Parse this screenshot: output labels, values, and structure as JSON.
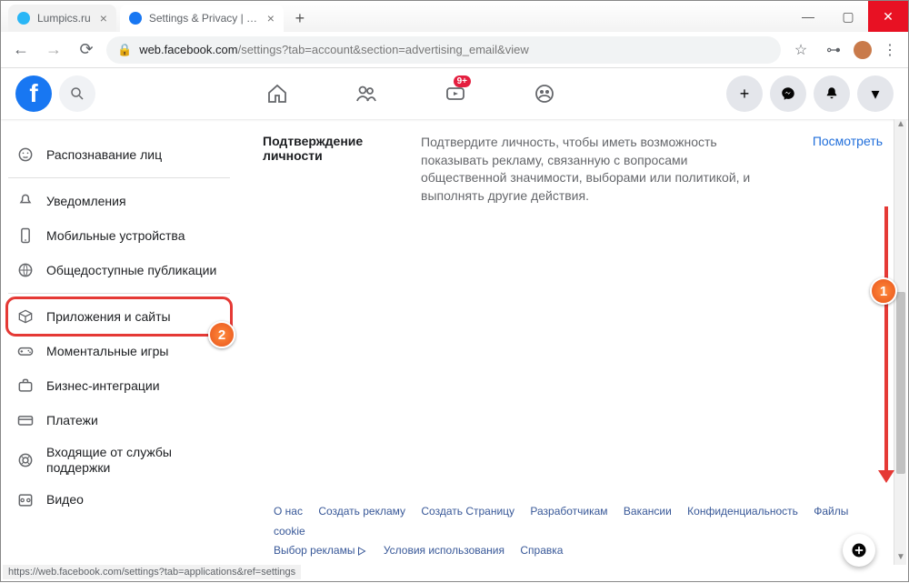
{
  "browser": {
    "tabs": [
      {
        "title": "Lumpics.ru",
        "favicon_color": "#29b6f6",
        "active": false
      },
      {
        "title": "Settings & Privacy | Facebook",
        "favicon_color": "#1877f2",
        "active": true
      }
    ],
    "url_host": "web.facebook.com",
    "url_path": "/settings?tab=account&section=advertising_email&view",
    "status_url": "https://web.facebook.com/settings?tab=applications&ref=settings"
  },
  "fb_header": {
    "logo_letter": "f",
    "watch_badge": "9+"
  },
  "sidebar": {
    "items": [
      {
        "label": "Распознавание лиц"
      },
      {
        "label": "Уведомления"
      },
      {
        "label": "Мобильные устройства"
      },
      {
        "label": "Общедоступные публикации"
      },
      {
        "label": "Приложения и сайты"
      },
      {
        "label": "Моментальные игры"
      },
      {
        "label": "Бизнес-интеграции"
      },
      {
        "label": "Платежи"
      },
      {
        "label": "Входящие от службы поддержки"
      },
      {
        "label": "Видео"
      }
    ]
  },
  "main": {
    "section_title": "Подтверждение личности",
    "section_desc": "Подтвердите личность, чтобы иметь возможность показывать рекламу, связанную с вопросами общественной значимости, выборами или политикой, и выполнять другие действия.",
    "section_action": "Посмотреть"
  },
  "footer": {
    "links": [
      "О нас",
      "Создать рекламу",
      "Создать Страницу",
      "Разработчикам",
      "Вакансии",
      "Конфиденциальность",
      "Файлы cookie",
      "Выбор рекламы",
      "Условия использования",
      "Справка"
    ]
  },
  "markers": {
    "m1": "1",
    "m2": "2"
  }
}
